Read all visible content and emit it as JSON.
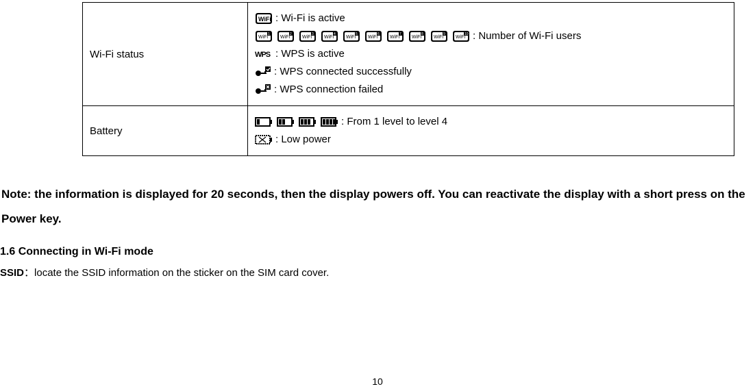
{
  "table": {
    "rows": [
      {
        "label": "Wi-Fi status",
        "items": [
          {
            "icon": "wifi-icon",
            "text": ": Wi-Fi is active"
          },
          {
            "icon": "wifi-users-icons",
            "text": ": Number of Wi-Fi users"
          },
          {
            "icon": "wps-icon",
            "text": ": WPS is active"
          },
          {
            "icon": "wps-ok-icon",
            "text": ": WPS connected successfully"
          },
          {
            "icon": "wps-fail-icon",
            "text": ": WPS connection failed"
          }
        ]
      },
      {
        "label": "Battery",
        "items": [
          {
            "icon": "battery-levels-icons",
            "text": ": From 1 level to level 4"
          },
          {
            "icon": "battery-low-icon",
            "text": ": Low power"
          }
        ]
      }
    ]
  },
  "note": "Note: the information is displayed for 20 seconds, then the display powers off. You can reactivate the display with a short press on the Power key.",
  "section": {
    "heading": "1.6 Connecting in Wi-Fi mode",
    "ssid_label": "SSID",
    "ssid_sep": "：",
    "ssid_text": "locate the SSID information on the sticker on the SIM card cover."
  },
  "page_number": "10"
}
